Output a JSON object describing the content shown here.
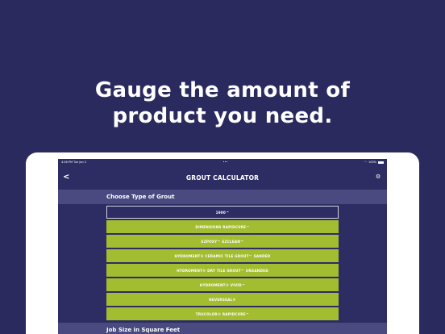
{
  "headline": {
    "line1": "Gauge the amount of",
    "line2": "product you need."
  },
  "status_bar": {
    "time": "4:46 PM",
    "date": "Tue Jan 2",
    "center": "•••",
    "battery_text": "100%"
  },
  "nav": {
    "title": "GROUT CALCULATOR",
    "back_glyph": "<",
    "settings_glyph": "⚙"
  },
  "sections": {
    "grout_type": "Choose Type of Grout",
    "job_size": "Job Size in Square Feet"
  },
  "grout_options": [
    {
      "label": "1900™",
      "selected": true
    },
    {
      "label": "DIMENSIONS RAPIDCURE™",
      "selected": false
    },
    {
      "label": "EZPOXY™ EZCLEAN™",
      "selected": false
    },
    {
      "label": "HYDROMENT® CERAMIC TILE GROUT™ SANDED",
      "selected": false
    },
    {
      "label": "HYDROMENT® DRY TILE GROUT™ UNSANDED",
      "selected": false
    },
    {
      "label": "HYDROMENT® VIVID™",
      "selected": false
    },
    {
      "label": "NEVERSEAL®",
      "selected": false
    },
    {
      "label": "TRUCOLOR® RAPIDCURE™",
      "selected": false
    }
  ],
  "colors": {
    "background": "#2b2a5e",
    "screen": "#2d2c63",
    "section_header": "#4a4a80",
    "option_green": "#a3bd31"
  }
}
